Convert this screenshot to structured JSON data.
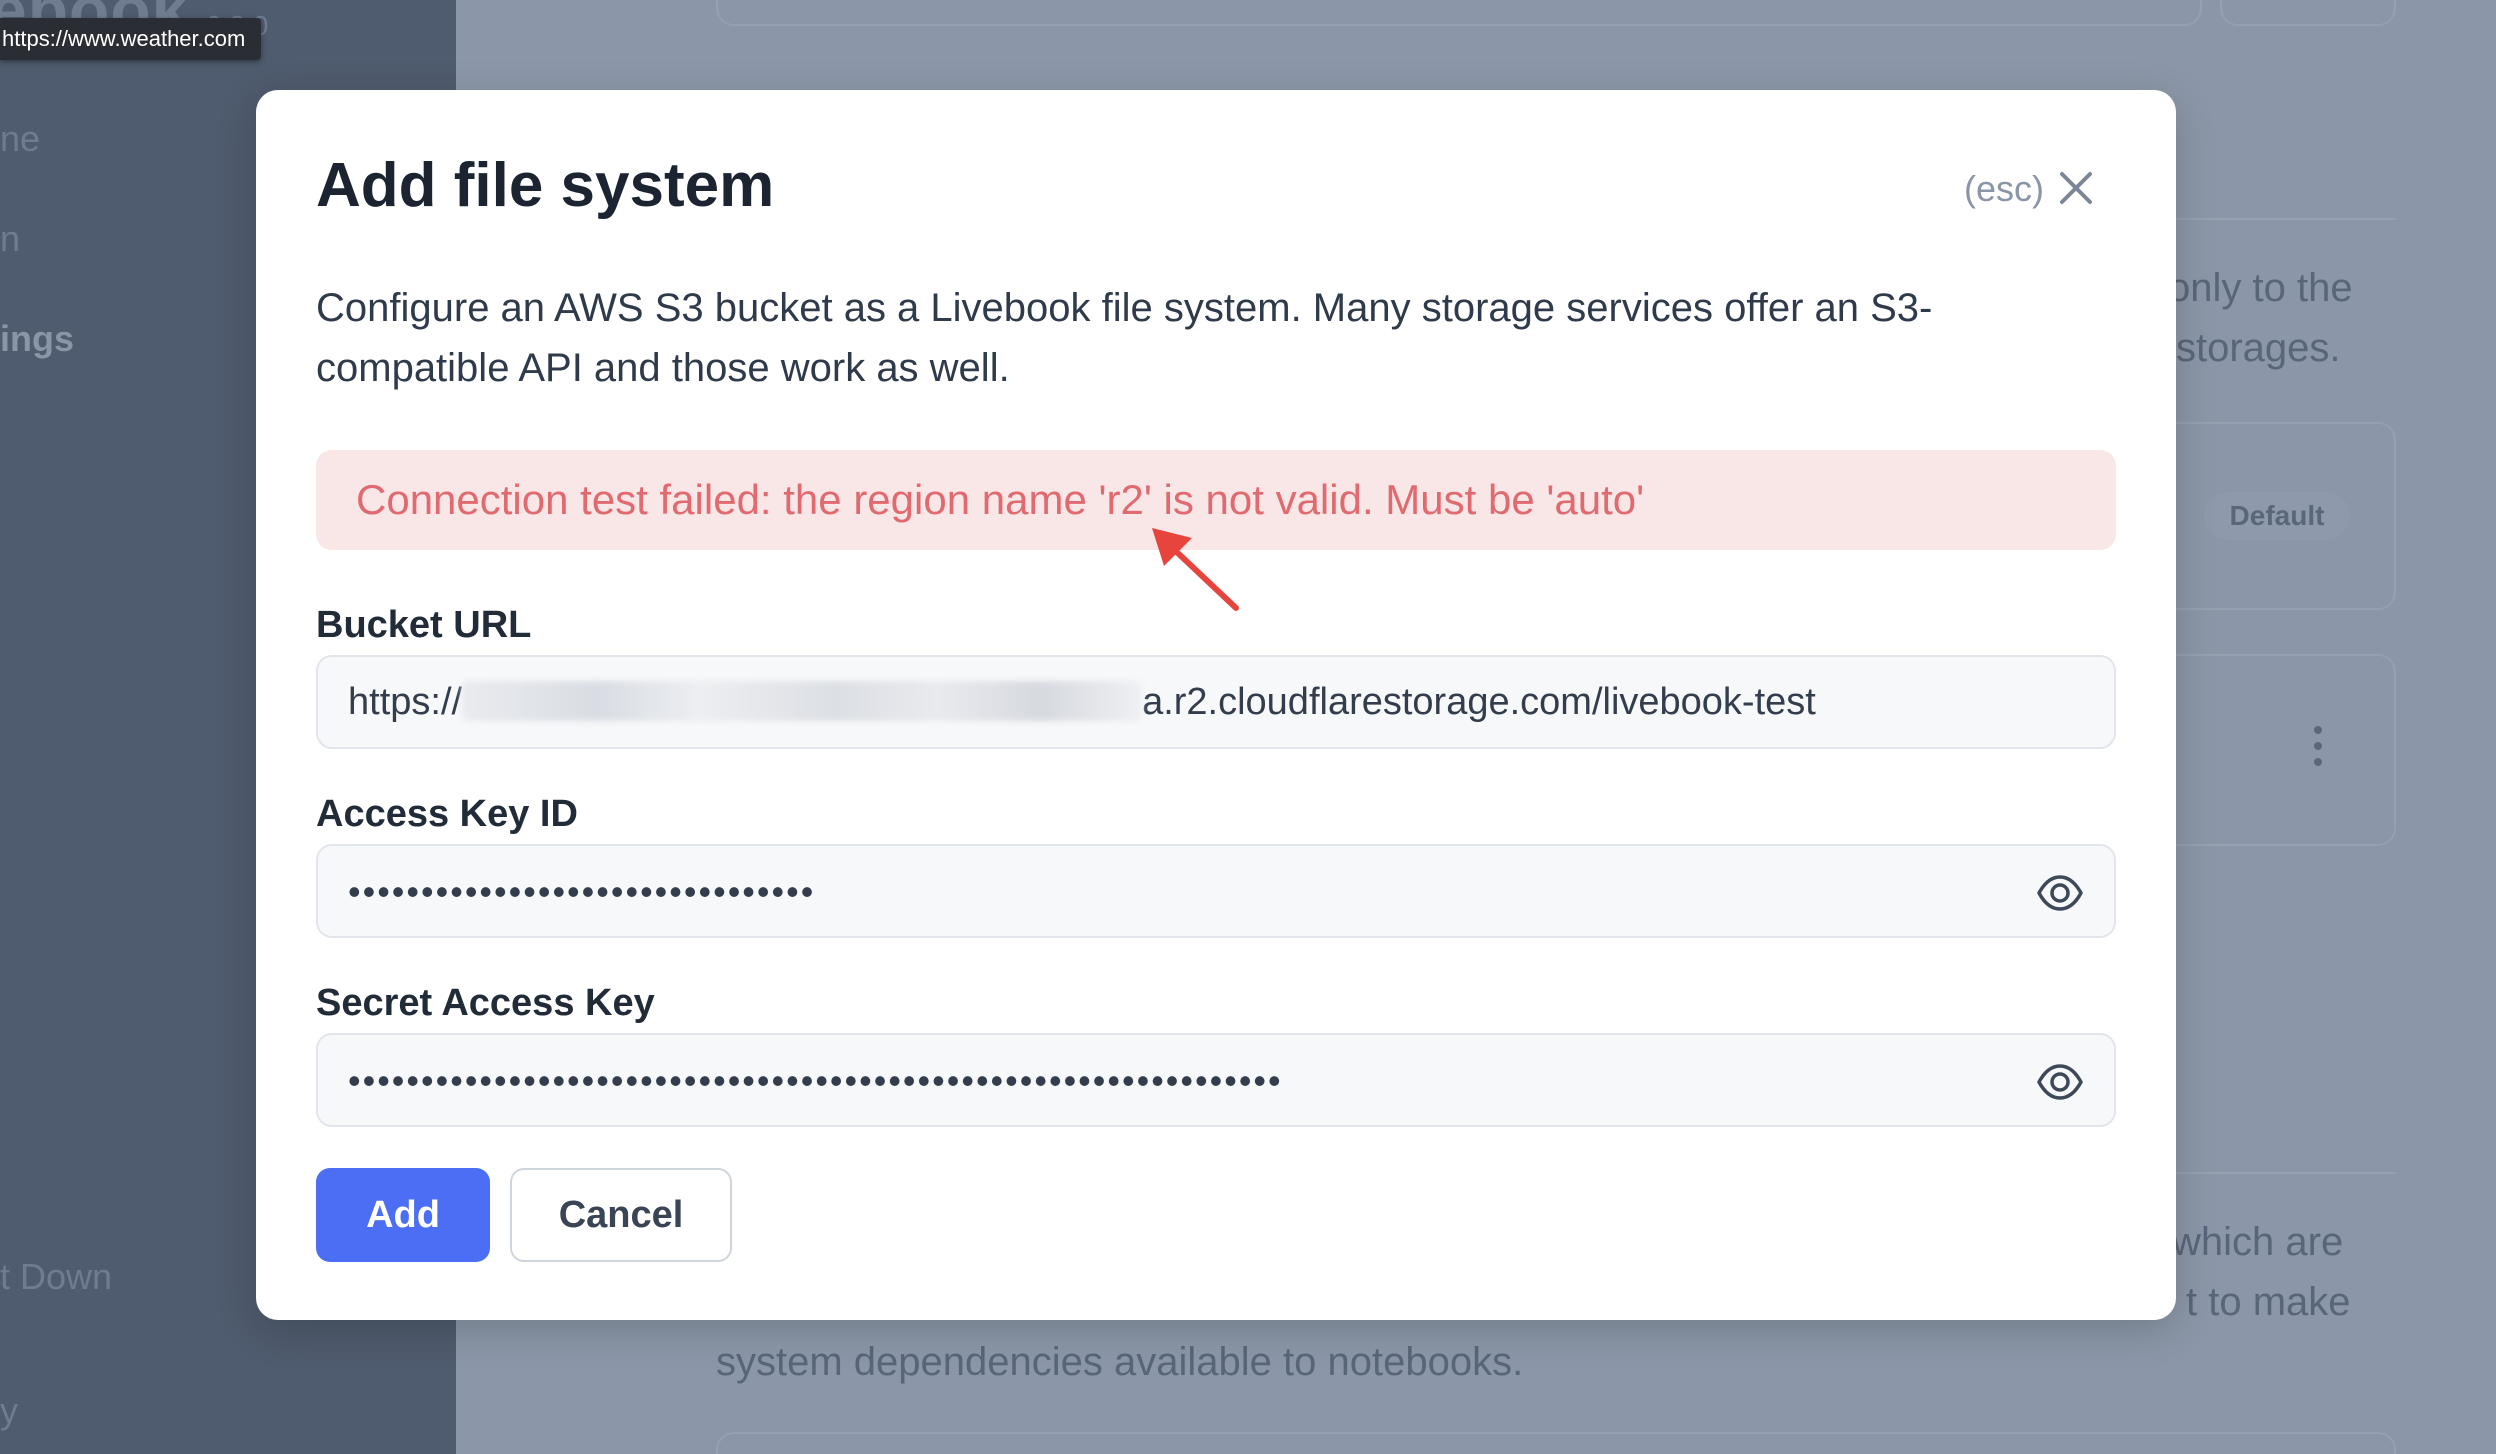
{
  "browser": {
    "status_url": "https://www.weather.com"
  },
  "sidebar": {
    "logo_fragment": "ebook",
    "version_fragment": "v0.8.0",
    "items": [
      {
        "label": "ne"
      },
      {
        "label": "n"
      },
      {
        "label": "ings"
      },
      {
        "label": "t Down"
      },
      {
        "label": "y"
      }
    ]
  },
  "background": {
    "text_right_1": "only to the",
    "text_right_2": "storages.",
    "default_badge": "Default",
    "text_bottom_1": "which are",
    "text_bottom_2": "t to make",
    "text_bottom_3": "system dependencies available to notebooks."
  },
  "modal": {
    "title": "Add file system",
    "esc_hint": "(esc)",
    "description": "Configure an AWS S3 bucket as a Livebook file system. Many storage services offer an S3-compatible API and those work as well.",
    "error": "Connection test failed: the region name 'r2' is not valid. Must be 'auto'",
    "bucket_url": {
      "label": "Bucket URL",
      "value_prefix": "https://",
      "value_suffix": "a.r2.cloudflarestorage.com/livebook-test"
    },
    "access_key_id": {
      "label": "Access Key ID",
      "masked_value": "••••••••••••••••••••••••••••••••"
    },
    "secret_access_key": {
      "label": "Secret Access Key",
      "masked_value": "••••••••••••••••••••••••••••••••••••••••••••••••••••••••••••••••"
    },
    "add_label": "Add",
    "cancel_label": "Cancel"
  },
  "colors": {
    "primary": "#4c6ef5",
    "error_text": "#e06a6f",
    "error_bg": "#f9e6e7",
    "annotation_arrow": "#e8443e"
  }
}
